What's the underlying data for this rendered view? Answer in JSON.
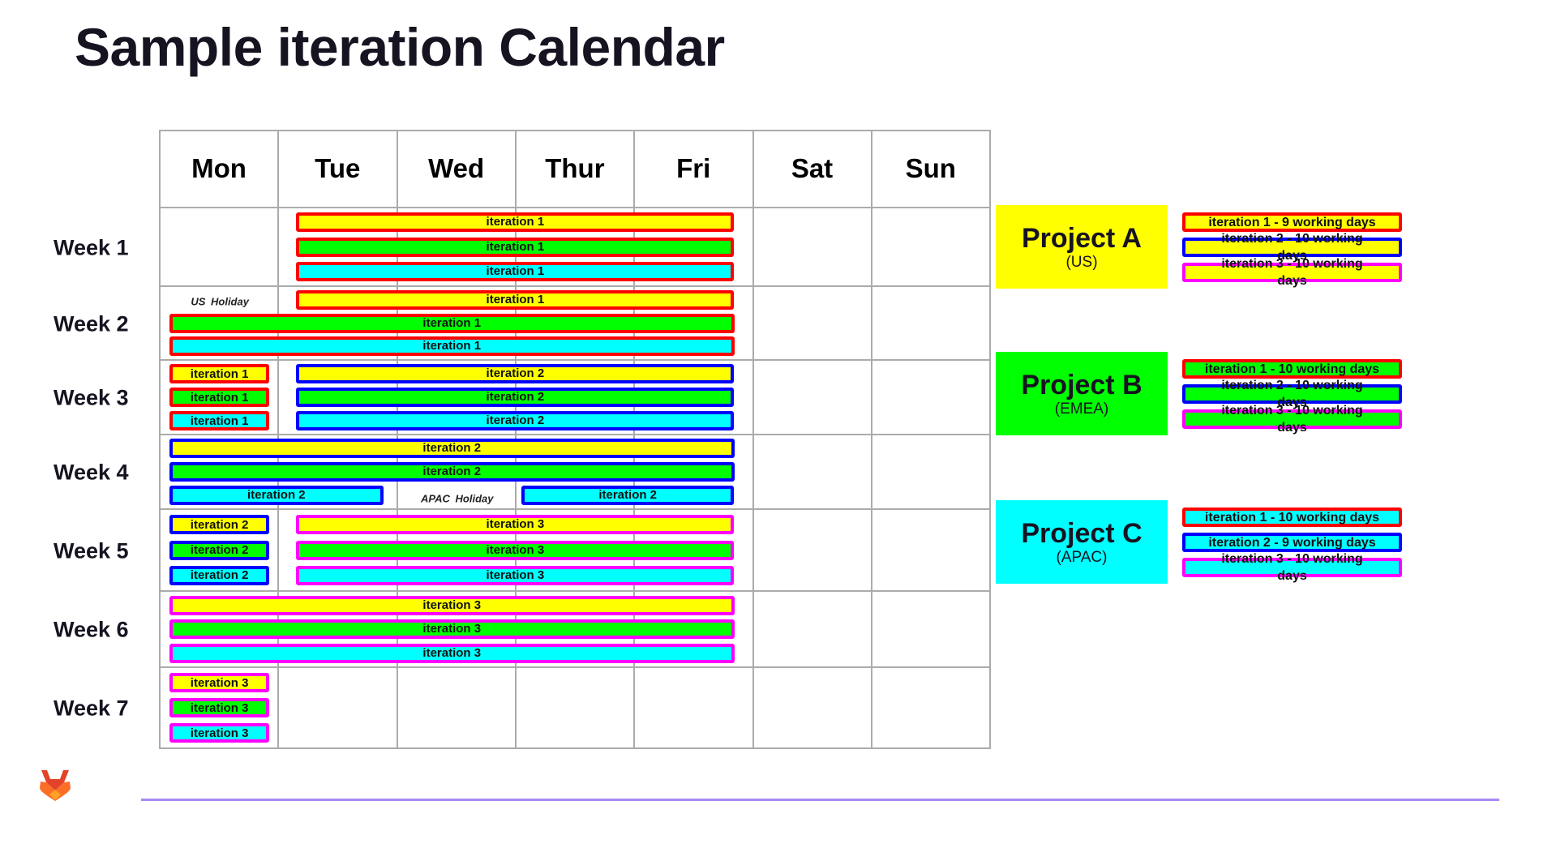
{
  "title": "Sample iteration Calendar",
  "colors": {
    "project_a": "#ffff00",
    "project_b": "#00ff00",
    "project_c": "#00ffff",
    "iteration_1_border": "#ff0000",
    "iteration_2_border": "#0000ff",
    "iteration_3_border": "#ff00ff",
    "grid": "#ababab",
    "footer_line": "#a989f5"
  },
  "days": [
    "Mon",
    "Tue",
    "Wed",
    "Thur",
    "Fri",
    "Sat",
    "Sun"
  ],
  "weeks": [
    "Week 1",
    "Week 2",
    "Week 3",
    "Week 4",
    "Week 5",
    "Week 6",
    "Week 7"
  ],
  "holidays": [
    {
      "label": "US Holiday",
      "week": 2,
      "day": "Mon"
    },
    {
      "label": "APAC  Holiday",
      "week": 4,
      "day": "Wed"
    }
  ],
  "projects": [
    {
      "id": "a",
      "name": "Project A",
      "region": "(US)",
      "color": "#ffff00",
      "legend": [
        {
          "label": "iteration 1 - 9 working days",
          "iteration": 1
        },
        {
          "label": "iteration 2 - 10 working days",
          "iteration": 2
        },
        {
          "label": "iteration 3 - 10 working days",
          "iteration": 3
        }
      ]
    },
    {
      "id": "b",
      "name": "Project B",
      "region": "(EMEA)",
      "color": "#00ff00",
      "legend": [
        {
          "label": "iteration 1 - 10 working days",
          "iteration": 1
        },
        {
          "label": "iteration 2 - 10 working days",
          "iteration": 2
        },
        {
          "label": "iteration 3 - 10 working days",
          "iteration": 3
        }
      ]
    },
    {
      "id": "c",
      "name": "Project C",
      "region": "(APAC)",
      "color": "#00ffff",
      "legend": [
        {
          "label": "iteration 1 - 10 working days",
          "iteration": 1
        },
        {
          "label": "iteration 2 - 9 working days",
          "iteration": 2
        },
        {
          "label": "iteration 3 - 10 working days",
          "iteration": 3
        }
      ]
    }
  ],
  "bars": [
    {
      "project": "a",
      "iteration": 1,
      "label": "iteration 1",
      "week": 1,
      "from": "Tue",
      "to": "Fri"
    },
    {
      "project": "b",
      "iteration": 1,
      "label": "iteration 1",
      "week": 1,
      "from": "Tue",
      "to": "Fri"
    },
    {
      "project": "c",
      "iteration": 1,
      "label": "iteration 1",
      "week": 1,
      "from": "Tue",
      "to": "Fri"
    },
    {
      "project": "a",
      "iteration": 1,
      "label": "iteration 1",
      "week": 2,
      "from": "Tue",
      "to": "Fri"
    },
    {
      "project": "b",
      "iteration": 1,
      "label": "iteration 1",
      "week": 2,
      "from": "Mon",
      "to": "Fri"
    },
    {
      "project": "c",
      "iteration": 1,
      "label": "iteration 1",
      "week": 2,
      "from": "Mon",
      "to": "Fri"
    },
    {
      "project": "a",
      "iteration": 1,
      "label": "iteration 1",
      "week": 3,
      "from": "Mon",
      "to": "Mon"
    },
    {
      "project": "b",
      "iteration": 1,
      "label": "iteration 1",
      "week": 3,
      "from": "Mon",
      "to": "Mon"
    },
    {
      "project": "c",
      "iteration": 1,
      "label": "iteration 1",
      "week": 3,
      "from": "Mon",
      "to": "Mon"
    },
    {
      "project": "a",
      "iteration": 2,
      "label": "iteration 2",
      "week": 3,
      "from": "Tue",
      "to": "Fri"
    },
    {
      "project": "b",
      "iteration": 2,
      "label": "iteration 2",
      "week": 3,
      "from": "Tue",
      "to": "Fri"
    },
    {
      "project": "c",
      "iteration": 2,
      "label": "iteration 2",
      "week": 3,
      "from": "Tue",
      "to": "Fri"
    },
    {
      "project": "a",
      "iteration": 2,
      "label": "iteration 2",
      "week": 4,
      "from": "Mon",
      "to": "Fri"
    },
    {
      "project": "b",
      "iteration": 2,
      "label": "iteration 2",
      "week": 4,
      "from": "Mon",
      "to": "Fri"
    },
    {
      "project": "c",
      "iteration": 2,
      "label": "iteration 2",
      "week": 4,
      "from": "Mon",
      "to": "Tue"
    },
    {
      "project": "c",
      "iteration": 2,
      "label": "iteration 2",
      "week": 4,
      "from": "Thur",
      "to": "Fri"
    },
    {
      "project": "a",
      "iteration": 2,
      "label": "iteration 2",
      "week": 5,
      "from": "Mon",
      "to": "Mon"
    },
    {
      "project": "b",
      "iteration": 2,
      "label": "iteration 2",
      "week": 5,
      "from": "Mon",
      "to": "Mon"
    },
    {
      "project": "c",
      "iteration": 2,
      "label": "iteration 2",
      "week": 5,
      "from": "Mon",
      "to": "Mon"
    },
    {
      "project": "a",
      "iteration": 3,
      "label": "iteration 3",
      "week": 5,
      "from": "Tue",
      "to": "Fri"
    },
    {
      "project": "b",
      "iteration": 3,
      "label": "iteration 3",
      "week": 5,
      "from": "Tue",
      "to": "Fri"
    },
    {
      "project": "c",
      "iteration": 3,
      "label": "iteration 3",
      "week": 5,
      "from": "Tue",
      "to": "Fri"
    },
    {
      "project": "a",
      "iteration": 3,
      "label": "iteration 3",
      "week": 6,
      "from": "Mon",
      "to": "Fri"
    },
    {
      "project": "b",
      "iteration": 3,
      "label": "iteration 3",
      "week": 6,
      "from": "Mon",
      "to": "Fri"
    },
    {
      "project": "c",
      "iteration": 3,
      "label": "iteration 3",
      "week": 6,
      "from": "Mon",
      "to": "Fri"
    },
    {
      "project": "a",
      "iteration": 3,
      "label": "iteration 3",
      "week": 7,
      "from": "Mon",
      "to": "Mon"
    },
    {
      "project": "b",
      "iteration": 3,
      "label": "iteration 3",
      "week": 7,
      "from": "Mon",
      "to": "Mon"
    },
    {
      "project": "c",
      "iteration": 3,
      "label": "iteration 3",
      "week": 7,
      "from": "Mon",
      "to": "Mon"
    }
  ],
  "logo": {
    "icon": "gitlab-tanuki-icon"
  }
}
